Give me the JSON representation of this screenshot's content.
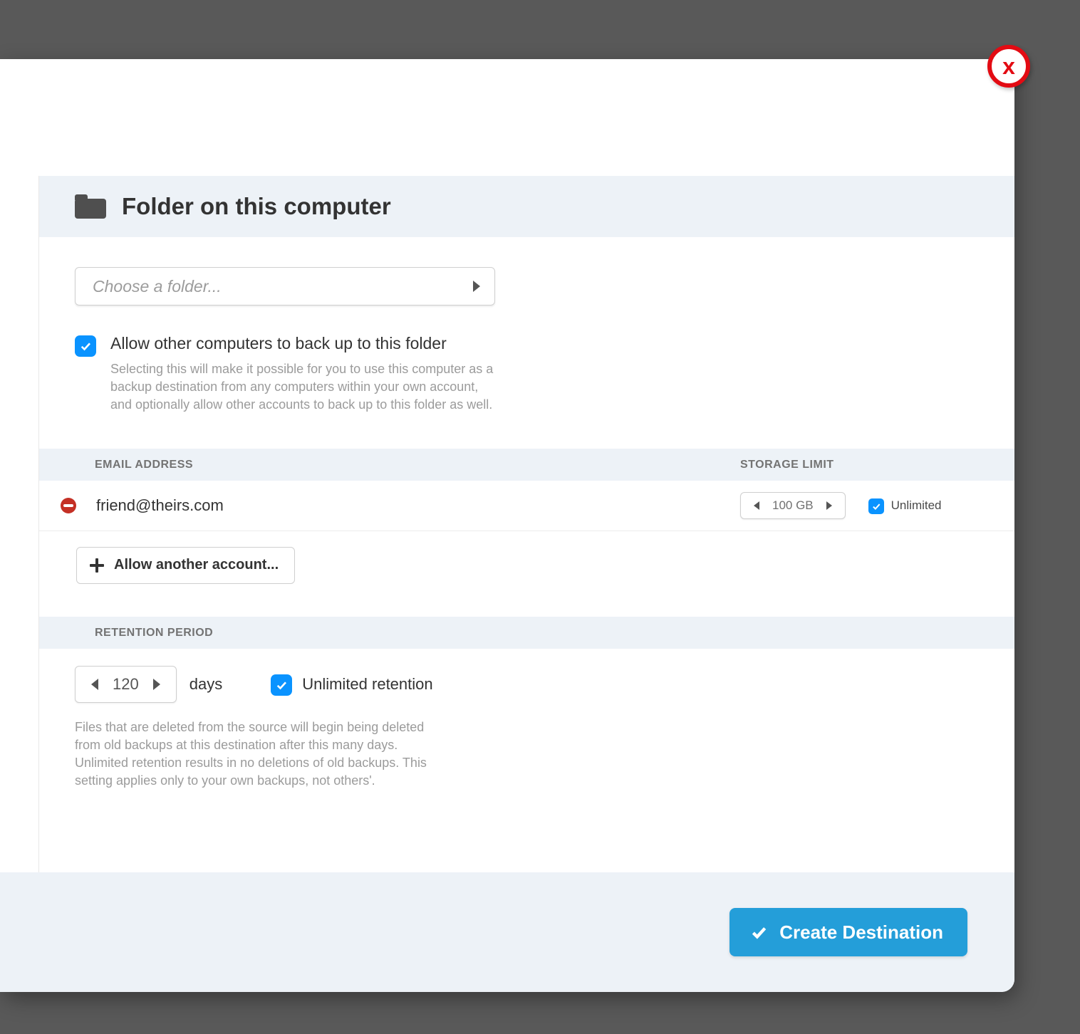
{
  "section_title": "Folder on this computer",
  "folder_picker": {
    "placeholder": "Choose a folder..."
  },
  "allow_other": {
    "label": "Allow other computers to back up to this folder",
    "description": "Selecting this will make it possible for you to use this computer as a backup destination from any computers within your own account, and optionally allow other accounts to back up to this folder as well.",
    "checked": true
  },
  "headers": {
    "email": "EMAIL ADDRESS",
    "storage": "STORAGE LIMIT",
    "retention": "RETENTION PERIOD"
  },
  "accounts": [
    {
      "email": "friend@theirs.com",
      "storage_value": "100 GB",
      "unlimited_label": "Unlimited",
      "unlimited_checked": true
    }
  ],
  "add_account_label": "Allow another account...",
  "retention": {
    "value": "120",
    "unit": "days",
    "unlimited_label": "Unlimited retention",
    "unlimited_checked": true,
    "description": "Files that are deleted from the source will begin being deleted from old backups at this destination after this many days. Unlimited retention results in no deletions of old backups. This setting applies only to your own backups, not others'."
  },
  "primary_button": "Create Destination",
  "close_glyph": "x"
}
